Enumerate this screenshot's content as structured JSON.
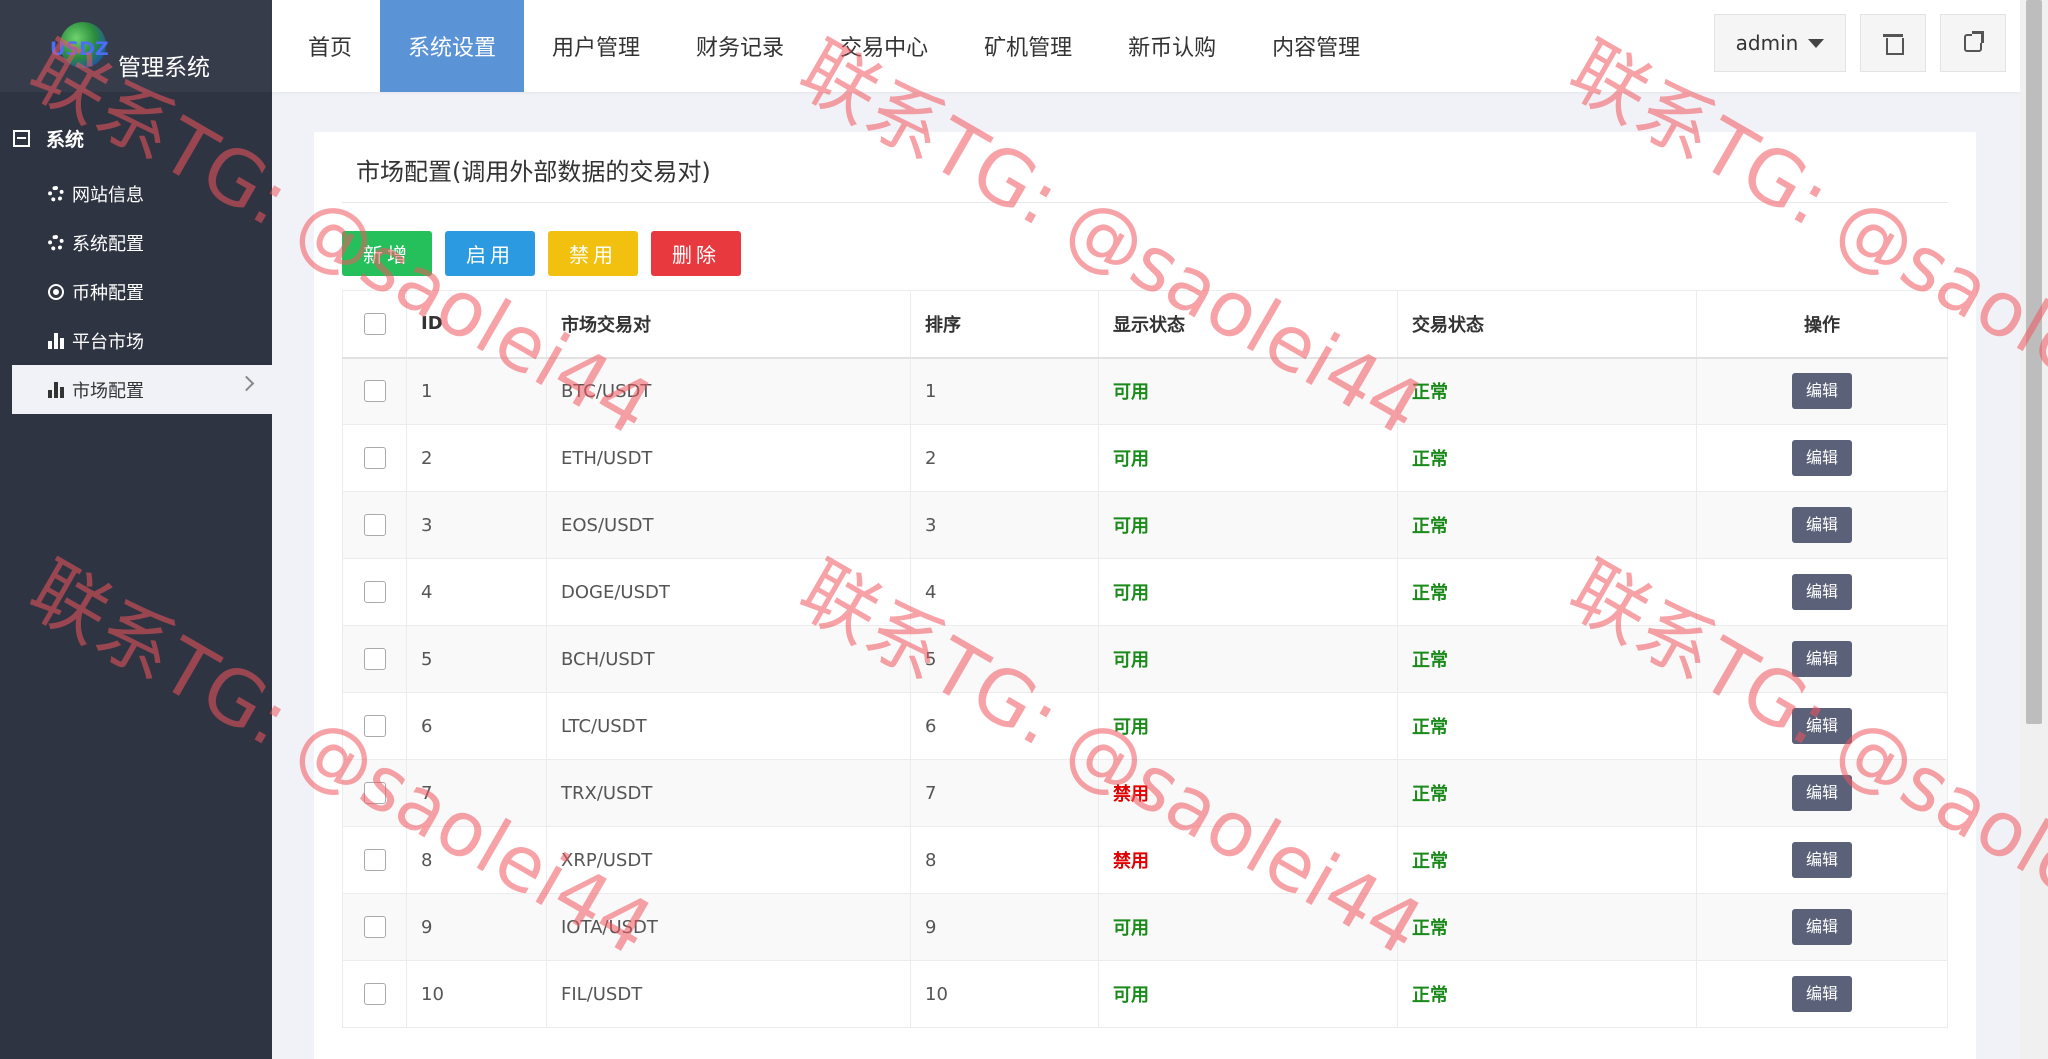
{
  "brand": {
    "logo_text": "USDZ",
    "title": "管理系统"
  },
  "sidebar": {
    "section": "系统",
    "items": [
      {
        "label": "网站信息",
        "icon": "gear-icon"
      },
      {
        "label": "系统配置",
        "icon": "gear-icon"
      },
      {
        "label": "币种配置",
        "icon": "target-icon"
      },
      {
        "label": "平台市场",
        "icon": "bar-chart-icon"
      },
      {
        "label": "市场配置",
        "icon": "bar-chart-icon",
        "active": true
      }
    ]
  },
  "topnav": {
    "items": [
      "首页",
      "系统设置",
      "用户管理",
      "财务记录",
      "交易中心",
      "矿机管理",
      "新币认购",
      "内容管理"
    ],
    "active": "系统设置",
    "user": "admin"
  },
  "panel": {
    "title": "市场配置(调用外部数据的交易对)",
    "buttons": {
      "add": "新增",
      "enable": "启用",
      "disable": "禁用",
      "delete": "删除"
    }
  },
  "table": {
    "headers": {
      "id": "ID",
      "pair": "市场交易对",
      "sort": "排序",
      "display": "显示状态",
      "trade": "交易状态",
      "op": "操作"
    },
    "edit_label": "编辑",
    "rows": [
      {
        "id": "1",
        "pair": "BTC/USDT",
        "sort": "1",
        "display": "可用",
        "trade": "正常"
      },
      {
        "id": "2",
        "pair": "ETH/USDT",
        "sort": "2",
        "display": "可用",
        "trade": "正常"
      },
      {
        "id": "3",
        "pair": "EOS/USDT",
        "sort": "3",
        "display": "可用",
        "trade": "正常"
      },
      {
        "id": "4",
        "pair": "DOGE/USDT",
        "sort": "4",
        "display": "可用",
        "trade": "正常"
      },
      {
        "id": "5",
        "pair": "BCH/USDT",
        "sort": "5",
        "display": "可用",
        "trade": "正常"
      },
      {
        "id": "6",
        "pair": "LTC/USDT",
        "sort": "6",
        "display": "可用",
        "trade": "正常"
      },
      {
        "id": "7",
        "pair": "TRX/USDT",
        "sort": "7",
        "display": "禁用",
        "trade": "正常"
      },
      {
        "id": "8",
        "pair": "XRP/USDT",
        "sort": "8",
        "display": "禁用",
        "trade": "正常"
      },
      {
        "id": "9",
        "pair": "IOTA/USDT",
        "sort": "9",
        "display": "可用",
        "trade": "正常"
      },
      {
        "id": "10",
        "pair": "FIL/USDT",
        "sort": "10",
        "display": "可用",
        "trade": "正常"
      }
    ]
  },
  "watermark": "联系TG: @saolei44",
  "colors": {
    "active_tab": "#5b94d6",
    "sidebar": "#2f3442",
    "ok": "#1a8a1a",
    "bad": "#e00000"
  }
}
